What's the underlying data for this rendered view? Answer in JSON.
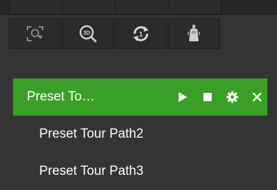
{
  "ptz_toolbar": {
    "buttons": [
      {
        "name": "area-focus",
        "icon": "area-focus-icon"
      },
      {
        "name": "3d-zoom",
        "icon": "3d-zoom-icon"
      },
      {
        "name": "one-touch-patrol",
        "icon": "patrol-icon"
      },
      {
        "name": "wiper",
        "icon": "wiper-icon"
      }
    ]
  },
  "tours": [
    {
      "label": "Preset To…",
      "active": true
    },
    {
      "label": "Preset Tour Path2",
      "active": false
    },
    {
      "label": "Preset Tour Path3",
      "active": false
    }
  ],
  "colors": {
    "active": "#3a9f27",
    "background": "#343434"
  }
}
